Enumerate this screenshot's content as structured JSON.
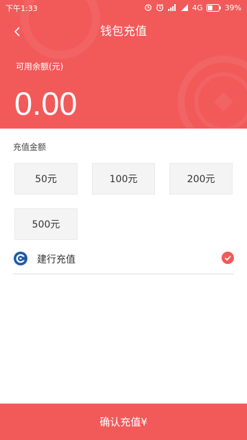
{
  "status_bar": {
    "time": "下午1:33",
    "network": "4G",
    "battery": "39%"
  },
  "header": {
    "title": "钱包充值"
  },
  "balance": {
    "label": "可用余额(元)",
    "value": "0.00"
  },
  "recharge": {
    "section_label": "充值金额",
    "options": [
      "50元",
      "100元",
      "200元",
      "500元"
    ]
  },
  "payment": {
    "method_label": "建行充值",
    "selected": true
  },
  "confirm": {
    "label": "确认充值¥"
  },
  "colors": {
    "accent": "#f25a5a"
  }
}
